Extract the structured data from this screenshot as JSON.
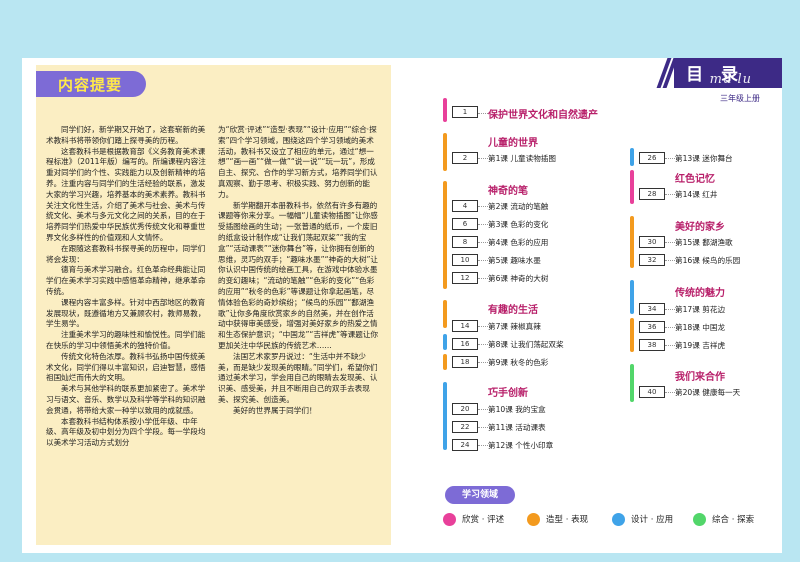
{
  "summary": {
    "title": "内容提要",
    "col1": [
      "同学们好，新学期又开始了，这套崭新的美术教科书将带领你们踏上探寻美的历程。",
      "这套教科书是根据教育部《义务教育美术课程标准》（2011年版）编写的。所编课程内容注重对同学们的个性、实践能力以及创新精神的培养。注重内容与同学们的生活经验的联系，激发大家的学习兴趣，培养基本的美术素养。教科书关注文化性生活，介绍了美术与社会、美术与传统文化、美术与多元文化之间的关系，目的在于培养同学们热爱中华民族优秀传统文化和尊重世界文化多样性的价值观和人文情怀。",
      "在跟随这套教科书探寻美的历程中，同学们将会发现：",
      "德育与美术学习融合。红色革命经典能让同学们在美术学习实践中感悟革命精神，继承革命传统。",
      "课程内容丰富多样。针对中西部地区的教育发展现状，既遵循地方又兼顾农村，教师易教，学生易学。",
      "注重美术学习的趣味性和愉悦性。同学们能在快乐的学习中领悟美术的独特价值。",
      "传统文化特色浓厚。教科书弘扬中国传统美术文化，同学们得以丰富知识，启迪智慧，感悟祖国灿烂而伟大的文明。",
      "美术与其他学科的联系更加紧密了。美术学习与语文、音乐、数学以及科学等学科的知识融会贯通，将带给大家一种学以致用的成就感。",
      "本套教科书结构体系按小学低年级、中年级、高年级及初中划分为四个学段。每一学段均以美术学习活动方式划分"
    ],
    "col2": [
      "为“欣赏·评述”“造型·表现”“设计·应用”“综合·探索”四个学习领域，围绕这四个学习领域的美术活动，教科书又设立了相应的单元，通过“想一想”“画一画”“做一做”“说一说”“玩一玩”，形成自主、探究、合作的学习新方式，培养同学们认真观察、勤于思考、积极实践、努力创新的能力。",
      "新学期翻开本册教科书，依然有许多有趣的课题等你来分享。一幅幅“儿童读物插图”让你感受插图绘画的生动；一张普通的纸币，一个废旧的纸盒设计制作成“让我们荡起双桨”“我的宝盒”“活动课表”“迷你舞台”等，让你拥有创新的思维，灵巧的双手；“趣味水墨”“神奇的大树”让你认识中国传统的绘画工具，在游戏中体验水墨的变幻趣味；“流动的笔触”“色彩的变化”“色彩的应用”“秋冬的色彩”等课题让你拿起画笔，尽情体验色彩的奇妙缤纷；“候鸟的乐园”“鄱湖渔歌”让你多角度欣赏家乡的自然美，并在创作活动中获得审美感受，增强对美好家乡的热爱之情和生态保护意识；“中国龙”“吉祥虎”等课题让你更加关注中华民族的传统艺术……",
      "法国艺术家罗丹说过：“生活中并不缺少美，而是缺少发现美的眼睛。”同学们，希望你们通过美术学习，学会用自己的眼睛去发现美、认识美、感受美，并且不断用自己的双手去表现美、探究美、创造美。",
      "美好的世界属于同学们！"
    ]
  },
  "header": {
    "title": "目 录",
    "pinyin": "mu lu",
    "grade": "三年级上册"
  },
  "toc_left": [
    {
      "section": "保护世界文化和自然遗产",
      "lessons": [
        {
          "page": "1",
          "lesson": ""
        }
      ]
    },
    {
      "section": "儿童的世界",
      "lessons": [
        {
          "page": "2",
          "lesson": "第1课  儿童读物插图"
        }
      ]
    },
    {
      "section": "神奇的笔",
      "lessons": [
        {
          "page": "4",
          "lesson": "第2课  流动的笔触"
        },
        {
          "page": "6",
          "lesson": "第3课  色彩的变化"
        },
        {
          "page": "8",
          "lesson": "第4课  色彩的应用"
        },
        {
          "page": "10",
          "lesson": "第5课  趣味水墨"
        },
        {
          "page": "12",
          "lesson": "第6课  神奇的大树"
        }
      ]
    },
    {
      "section": "有趣的生活",
      "lessons": [
        {
          "page": "14",
          "lesson": "第7课  辣椒真辣"
        },
        {
          "page": "16",
          "lesson": "第8课  让我们荡起双桨"
        },
        {
          "page": "18",
          "lesson": "第9课  秋冬的色彩"
        }
      ]
    },
    {
      "section": "巧手创新",
      "lessons": [
        {
          "page": "20",
          "lesson": "第10课  我的宝盒"
        },
        {
          "page": "22",
          "lesson": "第11课  活动课表"
        },
        {
          "page": "24",
          "lesson": "第12课  个性小印章"
        }
      ]
    }
  ],
  "toc_right": [
    {
      "section": "",
      "lessons": [
        {
          "page": "26",
          "lesson": "第13课  迷你舞台"
        }
      ]
    },
    {
      "section": "红色记忆",
      "lessons": [
        {
          "page": "28",
          "lesson": "第14课  红井"
        }
      ]
    },
    {
      "section": "美好的家乡",
      "lessons": [
        {
          "page": "30",
          "lesson": "第15课  鄱湖渔歌"
        },
        {
          "page": "32",
          "lesson": "第16课  候鸟的乐园"
        }
      ]
    },
    {
      "section": "传统的魅力",
      "lessons": [
        {
          "page": "34",
          "lesson": "第17课  剪花边"
        },
        {
          "page": "36",
          "lesson": "第18课  中国龙"
        },
        {
          "page": "38",
          "lesson": "第19课  吉祥虎"
        }
      ]
    },
    {
      "section": "我们来合作",
      "lessons": [
        {
          "page": "40",
          "lesson": "第20课  健康每一天"
        }
      ]
    }
  ],
  "legend": {
    "title": "学习领域",
    "items": [
      {
        "label": "欣赏 · 评述",
        "color": "#e8409a"
      },
      {
        "label": "造型 · 表现",
        "color": "#f39a1e"
      },
      {
        "label": "设计 · 应用",
        "color": "#3fa3e8"
      },
      {
        "label": "综合 · 探索",
        "color": "#52d66a"
      }
    ]
  },
  "colors": {
    "pink": "#e8409a",
    "orange": "#f39a1e",
    "blue": "#3fa3e8",
    "green": "#52d66a",
    "purple": "#7d6bd6",
    "navy": "#3d2a86"
  }
}
